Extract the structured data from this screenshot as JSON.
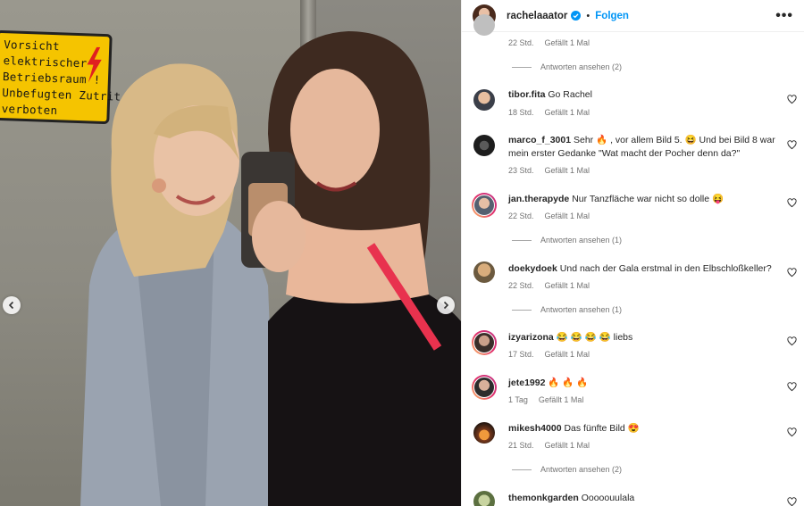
{
  "post": {
    "username": "rachelaaator",
    "follow_label": "Folgen",
    "dot": "•",
    "more_label": "•••"
  },
  "photo": {
    "sign_lines": [
      "Vorsicht",
      "elektrischer",
      "Betriebsraum !",
      "Unbefugten Zutrit",
      "verboten"
    ]
  },
  "top_meta": {
    "time": "22 Std.",
    "likes": "Gefällt 1 Mal",
    "replies": "Antworten ansehen (2)"
  },
  "comments": [
    {
      "user": "tibor.fita",
      "text": "Go Rachel",
      "time": "18 Std.",
      "likes": "Gefällt 1 Mal",
      "replies": ""
    },
    {
      "user": "marco_f_3001",
      "text": "Sehr 🔥 , vor allem Bild 5. 😆 Und bei Bild 8 war mein erster Gedanke \"Wat macht der Pocher denn da?\"",
      "time": "23 Std.",
      "likes": "Gefällt 1 Mal",
      "replies": ""
    },
    {
      "user": "jan.therapyde",
      "text": "Nur Tanzfläche war nicht so dolle 😝",
      "time": "22 Std.",
      "likes": "Gefällt 1 Mal",
      "replies": "Antworten ansehen (1)"
    },
    {
      "user": "doekydoek",
      "text": "Und nach der Gala erstmal in den Elbschloßkeller?",
      "time": "22 Std.",
      "likes": "Gefällt 1 Mal",
      "replies": "Antworten ansehen (1)"
    },
    {
      "user": "izyarizona",
      "text": "😂 😂 😂 😂 liebs",
      "time": "17 Std.",
      "likes": "Gefällt 1 Mal",
      "replies": ""
    },
    {
      "user": "jete1992",
      "text": "🔥 🔥 🔥",
      "time": "1 Tag",
      "likes": "Gefällt 1 Mal",
      "replies": ""
    },
    {
      "user": "mikesh4000",
      "text": "Das fünfte Bild 😍",
      "time": "21 Std.",
      "likes": "Gefällt 1 Mal",
      "replies": "Antworten ansehen (2)"
    },
    {
      "user": "themonkgarden",
      "text": "Ooooouulala",
      "time": "",
      "likes": "",
      "replies": ""
    }
  ],
  "colors": {
    "accent": "#0095f6",
    "verified": "#0095f6",
    "meta": "#737373",
    "sign": "#f5c400"
  },
  "icons": [
    "verified-badge-icon",
    "more-options-icon",
    "heart-icon",
    "chevron-left-icon",
    "chevron-right-icon",
    "lightning-bolt-icon"
  ]
}
